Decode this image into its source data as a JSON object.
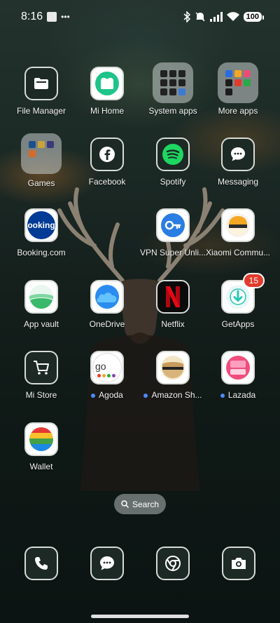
{
  "status": {
    "time": "8:16",
    "battery": "100"
  },
  "apps": [
    {
      "label": "File Manager",
      "icon": "folder-icon"
    },
    {
      "label": "Mi Home",
      "icon": "mi-home-icon"
    },
    {
      "label": "System apps",
      "icon": "folder-icon"
    },
    {
      "label": "More apps",
      "icon": "folder-icon"
    },
    {
      "label": "Games",
      "icon": "folder-icon"
    },
    {
      "label": "Facebook",
      "icon": "facebook-icon"
    },
    {
      "label": "Spotify",
      "icon": "spotify-icon"
    },
    {
      "label": "Messaging",
      "icon": "chat-bubble-icon"
    },
    {
      "label": "Booking.com",
      "icon": "booking-icon"
    },
    {
      "label": "VPN Super Unli...",
      "icon": "key-icon"
    },
    {
      "label": "Xiaomi Commu...",
      "icon": "xiaomi-community-icon"
    },
    {
      "label": "App vault",
      "icon": "app-vault-icon"
    },
    {
      "label": "OneDrive",
      "icon": "onedrive-icon"
    },
    {
      "label": "Netflix",
      "icon": "netflix-icon"
    },
    {
      "label": "GetApps",
      "icon": "getapps-icon",
      "badge": "15"
    },
    {
      "label": "Mi Store",
      "icon": "cart-icon"
    },
    {
      "label": "Agoda",
      "icon": "agoda-icon"
    },
    {
      "label": "Amazon Sh...",
      "icon": "amazon-icon"
    },
    {
      "label": "Lazada",
      "icon": "lazada-icon"
    },
    {
      "label": "Wallet",
      "icon": "wallet-icon"
    }
  ],
  "booking_text": "ooking",
  "search": {
    "label": "Search"
  },
  "dock": [
    {
      "name": "phone",
      "icon": "phone-icon"
    },
    {
      "name": "messages",
      "icon": "chat-bubble-icon"
    },
    {
      "name": "chrome",
      "icon": "chrome-icon"
    },
    {
      "name": "camera",
      "icon": "camera-icon"
    }
  ],
  "colors": {
    "accent_blue": "#4a8cff",
    "badge_red": "#e23b2c",
    "spotify_green": "#1ed760",
    "netflix_red": "#e50914"
  }
}
